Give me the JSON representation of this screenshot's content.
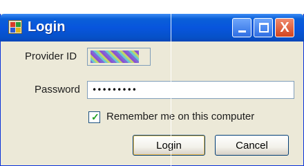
{
  "window": {
    "title": "Login"
  },
  "form": {
    "provider_label": "Provider ID",
    "password_label": "Password",
    "password_value": "•••••••••",
    "remember_label": "Remember me on this computer",
    "remember_checked": true
  },
  "buttons": {
    "login": "Login",
    "cancel": "Cancel"
  },
  "titlebar_buttons": {
    "close_glyph": "X"
  }
}
